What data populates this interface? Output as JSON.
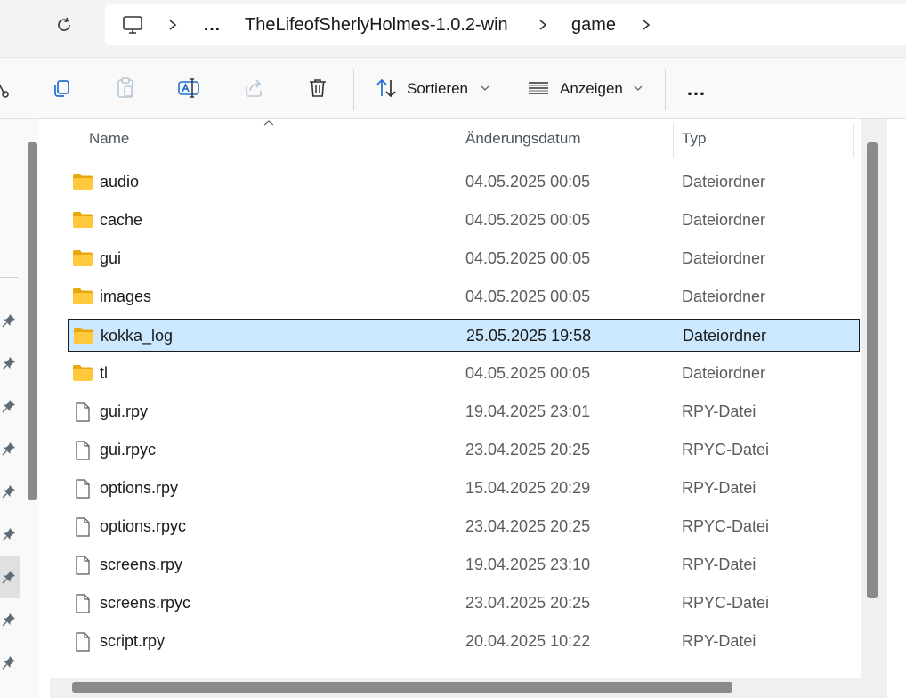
{
  "address_bar": {
    "breadcrumbs": [
      "TheLifeofSherlyHolmes-1.0.2-win",
      "game"
    ],
    "overflow_label": "…"
  },
  "toolbar": {
    "sort_label": "Sortieren",
    "view_label": "Anzeigen",
    "more_label": "…"
  },
  "list": {
    "columns": {
      "name": "Name",
      "date": "Änderungsdatum",
      "type": "Typ"
    },
    "rows": [
      {
        "name": "audio",
        "date": "04.05.2025 00:05",
        "type": "Dateiordner",
        "icon": "folder-icon"
      },
      {
        "name": "cache",
        "date": "04.05.2025 00:05",
        "type": "Dateiordner",
        "icon": "folder-icon"
      },
      {
        "name": "gui",
        "date": "04.05.2025 00:05",
        "type": "Dateiordner",
        "icon": "folder-icon"
      },
      {
        "name": "images",
        "date": "04.05.2025 00:05",
        "type": "Dateiordner",
        "icon": "folder-icon"
      },
      {
        "name": "kokka_log",
        "date": "25.05.2025 19:58",
        "type": "Dateiordner",
        "icon": "folder-icon",
        "selected": true
      },
      {
        "name": "tl",
        "date": "04.05.2025 00:05",
        "type": "Dateiordner",
        "icon": "folder-icon"
      },
      {
        "name": "gui.rpy",
        "date": "19.04.2025 23:01",
        "type": "RPY-Datei",
        "icon": "file-icon"
      },
      {
        "name": "gui.rpyc",
        "date": "23.04.2025 20:25",
        "type": "RPYC-Datei",
        "icon": "file-icon"
      },
      {
        "name": "options.rpy",
        "date": "15.04.2025 20:29",
        "type": "RPY-Datei",
        "icon": "file-icon"
      },
      {
        "name": "options.rpyc",
        "date": "23.04.2025 20:25",
        "type": "RPYC-Datei",
        "icon": "file-icon"
      },
      {
        "name": "screens.rpy",
        "date": "19.04.2025 23:10",
        "type": "RPY-Datei",
        "icon": "file-icon"
      },
      {
        "name": "screens.rpyc",
        "date": "23.04.2025 20:25",
        "type": "RPYC-Datei",
        "icon": "file-icon"
      },
      {
        "name": "script.rpy",
        "date": "20.04.2025 10:22",
        "type": "RPY-Datei",
        "icon": "file-icon"
      }
    ]
  },
  "colors": {
    "selection_bg": "#cce8ff",
    "folder_yellow": "#ffc83d"
  }
}
